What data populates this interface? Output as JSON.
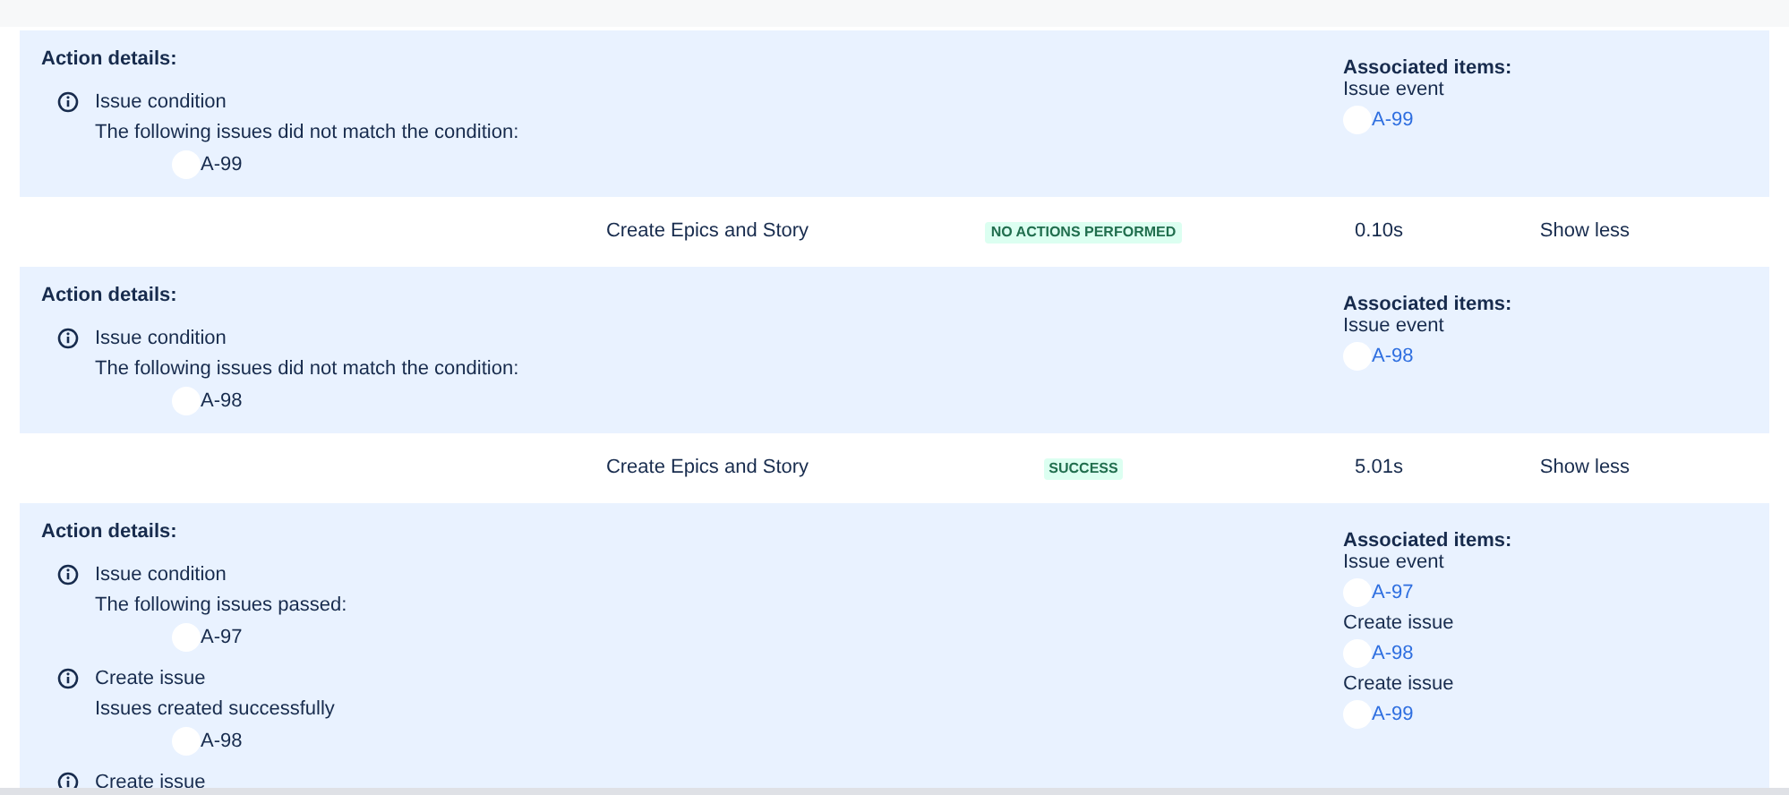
{
  "entries": [
    {
      "kind": "details",
      "action_label": "Action details:",
      "actions": [
        {
          "title": "Issue condition",
          "message": "The following issues did not match the condition:",
          "issues": [
            "A-99"
          ]
        }
      ],
      "associated_label": "Associated items:",
      "associated": [
        {
          "title": "Issue event",
          "issues": [
            "A-99"
          ]
        }
      ]
    },
    {
      "kind": "summary",
      "rule": "Create Epics and Story",
      "status": "NO ACTIONS PERFORMED",
      "duration": "0.10s",
      "toggle": "Show less"
    },
    {
      "kind": "details",
      "action_label": "Action details:",
      "actions": [
        {
          "title": "Issue condition",
          "message": "The following issues did not match the condition:",
          "issues": [
            "A-98"
          ]
        }
      ],
      "associated_label": "Associated items:",
      "associated": [
        {
          "title": "Issue event",
          "issues": [
            "A-98"
          ]
        }
      ]
    },
    {
      "kind": "summary",
      "rule": "Create Epics and Story",
      "status": "SUCCESS",
      "duration": "5.01s",
      "toggle": "Show less"
    },
    {
      "kind": "details",
      "action_label": "Action details:",
      "actions": [
        {
          "title": "Issue condition",
          "message": "The following issues passed:",
          "issues": [
            "A-97"
          ]
        },
        {
          "title": "Create issue",
          "message": "Issues created successfully",
          "issues": [
            "A-98"
          ]
        },
        {
          "title": "Create issue"
        }
      ],
      "associated_label": "Associated items:",
      "associated": [
        {
          "title": "Issue event",
          "issues": [
            "A-97"
          ]
        },
        {
          "title": "Create issue",
          "issues": [
            "A-98"
          ]
        },
        {
          "title": "Create issue",
          "issues": [
            "A-99"
          ]
        }
      ]
    }
  ]
}
